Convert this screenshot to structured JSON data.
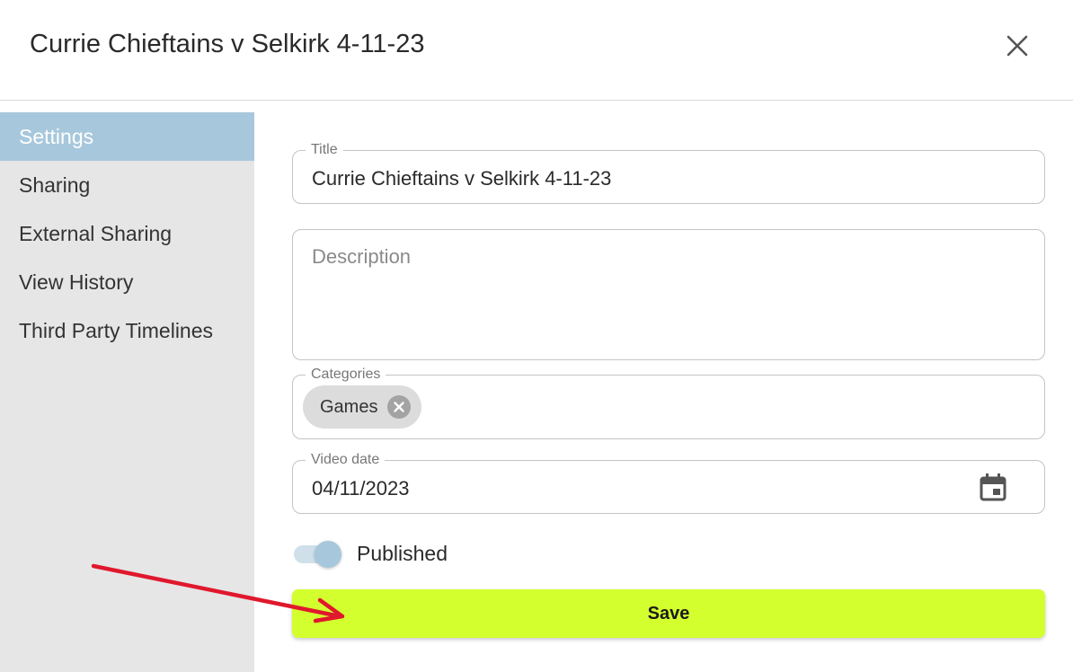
{
  "dialog": {
    "title": "Currie Chieftains v Selkirk 4-11-23",
    "close_icon": "close-icon"
  },
  "sidebar": {
    "active_color": "#a7c7dc",
    "items": [
      {
        "label": "Settings",
        "active": true
      },
      {
        "label": "Sharing",
        "active": false
      },
      {
        "label": "External Sharing",
        "active": false
      },
      {
        "label": "View History",
        "active": false
      },
      {
        "label": "Third Party Timelines",
        "active": false
      }
    ]
  },
  "form": {
    "title_field": {
      "label": "Title",
      "value": "Currie Chieftains v Selkirk 4-11-23"
    },
    "description_field": {
      "placeholder": "Description",
      "value": ""
    },
    "categories_field": {
      "label": "Categories",
      "chips": [
        {
          "label": "Games",
          "remove_icon": "close-circle-icon"
        }
      ]
    },
    "video_date_field": {
      "label": "Video date",
      "value": "04/11/2023",
      "icon": "calendar-icon"
    },
    "published_toggle": {
      "label": "Published",
      "checked": true
    },
    "save_button": {
      "label": "Save",
      "color": "#d4ff2e"
    }
  },
  "annotation": {
    "type": "red-arrow",
    "color": "#e0182d",
    "points_to": "save-button"
  }
}
